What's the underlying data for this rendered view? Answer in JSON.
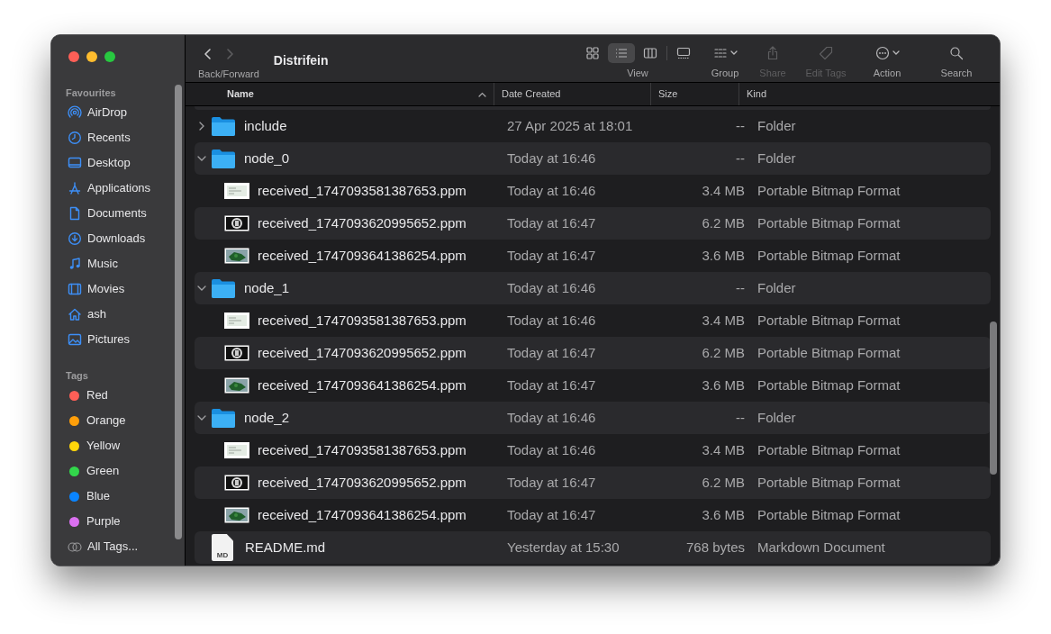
{
  "window": {
    "title": "Distrifein"
  },
  "toolbar": {
    "nav_label": "Back/Forward",
    "back_disabled": false,
    "forward_disabled": true,
    "view": {
      "label": "View",
      "modes": [
        {
          "selected": false
        },
        {
          "selected": true
        },
        {
          "selected": false
        },
        {
          "selected": false
        }
      ]
    },
    "actions": [
      {
        "label": "Group",
        "disabled": false,
        "menu": true
      },
      {
        "label": "Share",
        "disabled": true,
        "menu": false
      },
      {
        "label": "Edit Tags",
        "disabled": true,
        "menu": false
      },
      {
        "label": "Action",
        "disabled": false,
        "menu": true
      },
      {
        "label": "Search",
        "disabled": false,
        "menu": false
      }
    ]
  },
  "sidebar": {
    "sections": [
      {
        "title": "Favourites",
        "items": [
          {
            "label": "AirDrop"
          },
          {
            "label": "Recents"
          },
          {
            "label": "Desktop"
          },
          {
            "label": "Applications"
          },
          {
            "label": "Documents"
          },
          {
            "label": "Downloads"
          },
          {
            "label": "Music"
          },
          {
            "label": "Movies"
          },
          {
            "label": "ash"
          },
          {
            "label": "Pictures"
          }
        ]
      },
      {
        "title": "Tags",
        "items": [
          {
            "label": "Red",
            "color": "#ff5f57"
          },
          {
            "label": "Orange",
            "color": "#ff9f0a"
          },
          {
            "label": "Yellow",
            "color": "#ffd60a"
          },
          {
            "label": "Green",
            "color": "#32d74b"
          },
          {
            "label": "Blue",
            "color": "#0a84ff"
          },
          {
            "label": "Purple",
            "color": "#da70f0"
          },
          {
            "label": "All Tags..."
          }
        ]
      }
    ]
  },
  "table": {
    "columns": [
      {
        "label": "Name",
        "sorted": true
      },
      {
        "label": "Date Created",
        "sorted": false
      },
      {
        "label": "Size",
        "sorted": false
      },
      {
        "label": "Kind",
        "sorted": false
      }
    ],
    "rows": [
      {
        "kind": "folder",
        "name": "include",
        "date": "27 Apr 2025 at 18:01",
        "size": "--",
        "type": "Folder",
        "expanded": false
      },
      {
        "kind": "folder",
        "name": "node_0",
        "date": "Today at 16:46",
        "size": "--",
        "type": "Folder",
        "expanded": true,
        "children": [
          {
            "name": "received_1747093581387653.ppm",
            "date": "Today at 16:46",
            "size": "3.4 MB",
            "type": "Portable Bitmap Format"
          },
          {
            "name": "received_1747093620995652.ppm",
            "date": "Today at 16:47",
            "size": "6.2 MB",
            "type": "Portable Bitmap Format"
          },
          {
            "name": "received_1747093641386254.ppm",
            "date": "Today at 16:47",
            "size": "3.6 MB",
            "type": "Portable Bitmap Format"
          }
        ]
      },
      {
        "kind": "folder",
        "name": "node_1",
        "date": "Today at 16:46",
        "size": "--",
        "type": "Folder",
        "expanded": true,
        "children": [
          {
            "name": "received_1747093581387653.ppm",
            "date": "Today at 16:46",
            "size": "3.4 MB",
            "type": "Portable Bitmap Format"
          },
          {
            "name": "received_1747093620995652.ppm",
            "date": "Today at 16:47",
            "size": "6.2 MB",
            "type": "Portable Bitmap Format"
          },
          {
            "name": "received_1747093641386254.ppm",
            "date": "Today at 16:47",
            "size": "3.6 MB",
            "type": "Portable Bitmap Format"
          }
        ]
      },
      {
        "kind": "folder",
        "name": "node_2",
        "date": "Today at 16:46",
        "size": "--",
        "type": "Folder",
        "expanded": true,
        "children": [
          {
            "name": "received_1747093581387653.ppm",
            "date": "Today at 16:46",
            "size": "3.4 MB",
            "type": "Portable Bitmap Format"
          },
          {
            "name": "received_1747093620995652.ppm",
            "date": "Today at 16:47",
            "size": "6.2 MB",
            "type": "Portable Bitmap Format"
          },
          {
            "name": "received_1747093641386254.ppm",
            "date": "Today at 16:47",
            "size": "3.6 MB",
            "type": "Portable Bitmap Format"
          }
        ]
      },
      {
        "kind": "document",
        "name": "README.md",
        "date": "Yesterday at 15:30",
        "size": "768 bytes",
        "type": "Markdown Document",
        "icon_label": "MD"
      }
    ]
  }
}
